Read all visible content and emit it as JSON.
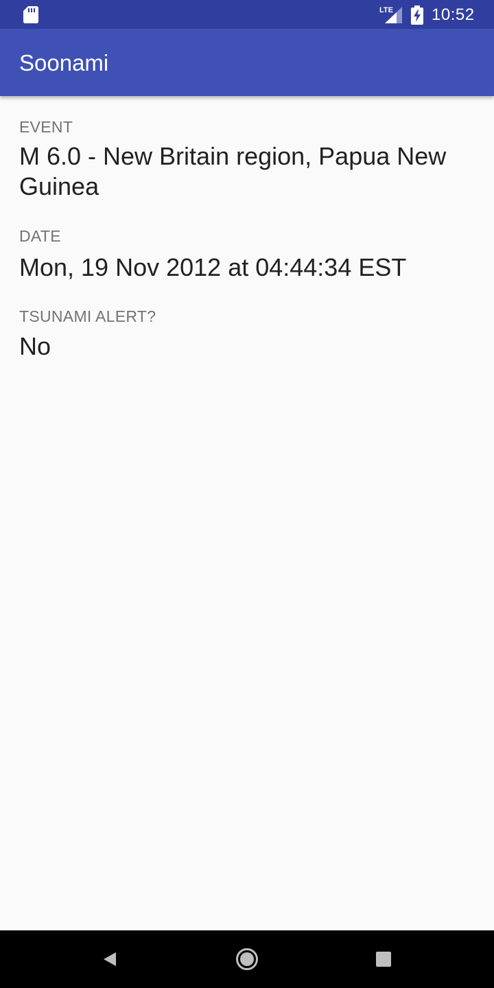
{
  "status_bar": {
    "time": "10:52",
    "network": "LTE",
    "icons": [
      "sd-card-icon",
      "lte-signal-icon",
      "battery-charging-icon"
    ]
  },
  "app_bar": {
    "title": "Soonami",
    "color": "#3f51b5",
    "status_color": "#303f9f"
  },
  "event": {
    "label": "EVENT",
    "value": "M 6.0 - New Britain region, Papua New Guinea"
  },
  "date": {
    "label": "DATE",
    "value": "Mon, 19 Nov 2012 at 04:44:34 EST"
  },
  "tsunami": {
    "label": "TSUNAMI ALERT?",
    "value": "No"
  },
  "nav_bar": {
    "icons": [
      "back-icon",
      "home-icon",
      "recents-icon"
    ]
  }
}
